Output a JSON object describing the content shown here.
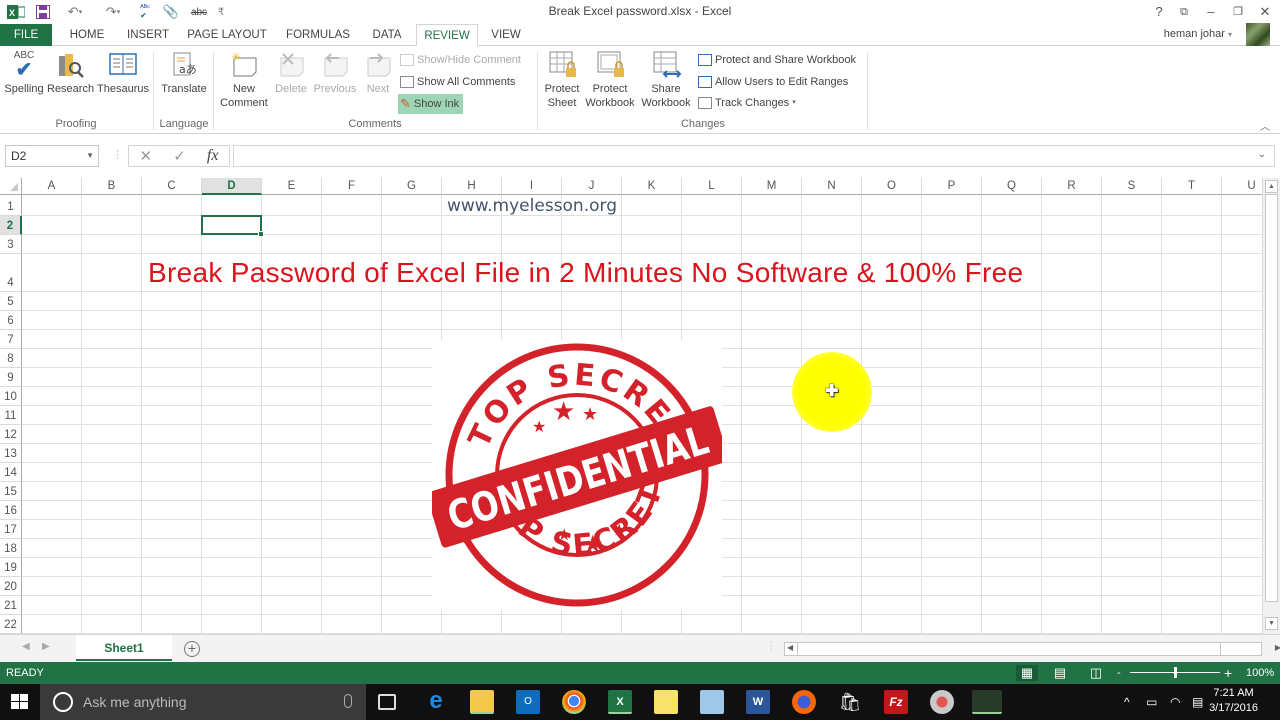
{
  "window": {
    "title": "Break Excel password.xlsx - Excel",
    "user": "heman johar",
    "controls": {
      "help": "?",
      "ribbon_display": "⧉",
      "minimize": "–",
      "restore": "❐",
      "close": "✕"
    }
  },
  "quick_access": [
    "excel-logo",
    "save",
    "undo",
    "redo",
    "spelling",
    "attach",
    "strikethrough",
    "customize"
  ],
  "tabs": [
    {
      "label": "FILE",
      "active": false
    },
    {
      "label": "HOME",
      "active": false
    },
    {
      "label": "INSERT",
      "active": false
    },
    {
      "label": "PAGE LAYOUT",
      "active": false
    },
    {
      "label": "FORMULAS",
      "active": false
    },
    {
      "label": "DATA",
      "active": false
    },
    {
      "label": "REVIEW",
      "active": true
    },
    {
      "label": "VIEW",
      "active": false
    }
  ],
  "ribbon": {
    "groups": {
      "proofing": "Proofing",
      "language": "Language",
      "comments": "Comments",
      "changes": "Changes"
    },
    "buttons": {
      "spelling": "Spelling",
      "spelling_abc": "ABC",
      "research": "Research",
      "thesaurus": "Thesaurus",
      "translate": "Translate",
      "new_comment_1": "New",
      "new_comment_2": "Comment",
      "delete": "Delete",
      "previous": "Previous",
      "next": "Next",
      "show_hide_comment": "Show/Hide Comment",
      "show_all_comments": "Show All Comments",
      "show_ink": "Show Ink",
      "protect_sheet_1": "Protect",
      "protect_sheet_2": "Sheet",
      "protect_workbook_1": "Protect",
      "protect_workbook_2": "Workbook",
      "share_workbook_1": "Share",
      "share_workbook_2": "Workbook",
      "protect_share": "Protect and Share Workbook",
      "allow_users": "Allow Users to Edit Ranges",
      "track_changes": "Track Changes"
    }
  },
  "formula_bar": {
    "name_box": "D2",
    "fx": "fx",
    "cancel": "✕",
    "enter": "✓",
    "value": ""
  },
  "grid": {
    "columns": [
      "A",
      "B",
      "C",
      "D",
      "E",
      "F",
      "G",
      "H",
      "I",
      "J",
      "K",
      "L",
      "M",
      "N",
      "O",
      "P",
      "Q",
      "R",
      "S",
      "T",
      "U"
    ],
    "rows": [
      "1",
      "2",
      "3",
      "4",
      "5",
      "6",
      "7",
      "8",
      "9",
      "10",
      "11",
      "12",
      "13",
      "14",
      "15",
      "16",
      "17",
      "18",
      "19",
      "20",
      "21",
      "22"
    ],
    "selected_cell": "D2",
    "selected_col": "D",
    "selected_row": "2",
    "cells": {
      "H1": "www.myelesson.org",
      "C4": "Break Password of Excel File in 2 Minutes No Software & 100% Free"
    }
  },
  "image": {
    "alt": "Top Secret Confidential stamp",
    "top_text": "TOP SECRET",
    "band_text": "CONFIDENTIAL",
    "bottom_text": "TOP SECRET",
    "color": "#d4222a"
  },
  "sheets": [
    {
      "name": "Sheet1",
      "active": true
    }
  ],
  "add_sheet": "+",
  "status": {
    "mode": "READY",
    "zoom": "100%",
    "zoom_minus": "-",
    "zoom_plus": "+",
    "zoom_fraction": 0.5
  },
  "taskbar": {
    "search_placeholder": "Ask me anything",
    "apps": [
      "task-view",
      "edge",
      "file-explorer",
      "outlook",
      "chrome",
      "excel",
      "sticky-notes",
      "notepad",
      "word",
      "firefox",
      "store",
      "filezilla",
      "snipping-tool",
      "app-running"
    ],
    "time": "7:21 AM",
    "date": "3/17/2016"
  },
  "colors": {
    "excel_green": "#217346",
    "headline_red": "#d9141c",
    "link_gray": "#44546a",
    "highlight_yellow": "#ffff00"
  }
}
